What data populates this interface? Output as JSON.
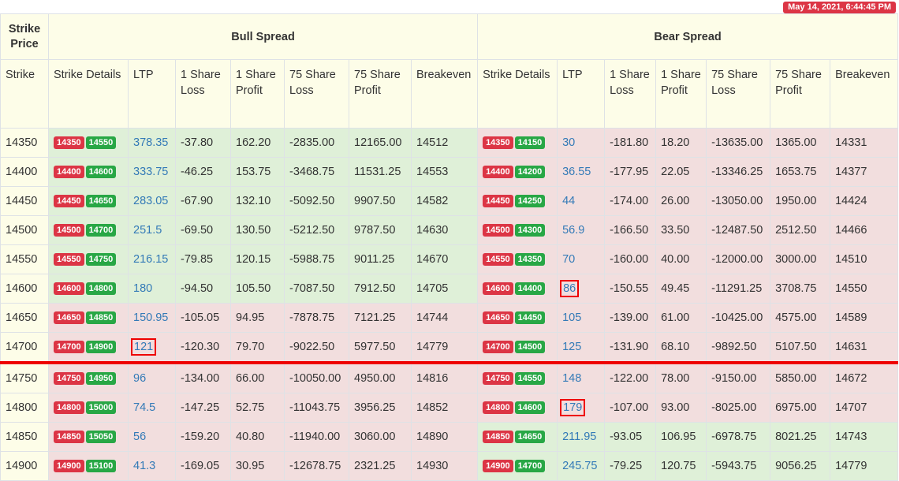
{
  "timestamp": "May 14, 2021, 6:44:45 PM",
  "header": {
    "strike_price": "Strike Price",
    "bull_spread": "Bull Spread",
    "bear_spread": "Bear Spread",
    "columns": [
      "Strike",
      "Strike Details",
      "LTP",
      "1 Share Loss",
      "1 Share Profit",
      "75 Share Loss",
      "75 Share Profit",
      "Breakeven",
      "Strike Details",
      "LTP",
      "1 Share Loss",
      "1 Share Profit",
      "75 Share Loss",
      "75 Share Profit",
      "Breakeven"
    ]
  },
  "colors": {
    "bull_bg": "#dff0d8",
    "bear_bg": "#f2dede",
    "header_bg": "#fdfde8",
    "pill_low": "#dc3545",
    "pill_high": "#28a745",
    "ltp": "#337ab7"
  },
  "rows": [
    {
      "strike": "14350",
      "bull": {
        "k1": "14350",
        "k2": "14550",
        "ltp": "378.35",
        "loss1": "-37.80",
        "profit1": "162.20",
        "loss75": "-2835.00",
        "profit75": "12165.00",
        "be": "14512"
      },
      "bear": {
        "k1": "14350",
        "k2": "14150",
        "ltp": "30",
        "loss1": "-181.80",
        "profit1": "18.20",
        "loss75": "-13635.00",
        "profit75": "1365.00",
        "be": "14331"
      },
      "bull_color": "g",
      "bear_color": "r"
    },
    {
      "strike": "14400",
      "bull": {
        "k1": "14400",
        "k2": "14600",
        "ltp": "333.75",
        "loss1": "-46.25",
        "profit1": "153.75",
        "loss75": "-3468.75",
        "profit75": "11531.25",
        "be": "14553"
      },
      "bear": {
        "k1": "14400",
        "k2": "14200",
        "ltp": "36.55",
        "loss1": "-177.95",
        "profit1": "22.05",
        "loss75": "-13346.25",
        "profit75": "1653.75",
        "be": "14377"
      },
      "bull_color": "g",
      "bear_color": "r"
    },
    {
      "strike": "14450",
      "bull": {
        "k1": "14450",
        "k2": "14650",
        "ltp": "283.05",
        "loss1": "-67.90",
        "profit1": "132.10",
        "loss75": "-5092.50",
        "profit75": "9907.50",
        "be": "14582"
      },
      "bear": {
        "k1": "14450",
        "k2": "14250",
        "ltp": "44",
        "loss1": "-174.00",
        "profit1": "26.00",
        "loss75": "-13050.00",
        "profit75": "1950.00",
        "be": "14424"
      },
      "bull_color": "g",
      "bear_color": "r"
    },
    {
      "strike": "14500",
      "bull": {
        "k1": "14500",
        "k2": "14700",
        "ltp": "251.5",
        "loss1": "-69.50",
        "profit1": "130.50",
        "loss75": "-5212.50",
        "profit75": "9787.50",
        "be": "14630"
      },
      "bear": {
        "k1": "14500",
        "k2": "14300",
        "ltp": "56.9",
        "loss1": "-166.50",
        "profit1": "33.50",
        "loss75": "-12487.50",
        "profit75": "2512.50",
        "be": "14466"
      },
      "bull_color": "g",
      "bear_color": "r"
    },
    {
      "strike": "14550",
      "bull": {
        "k1": "14550",
        "k2": "14750",
        "ltp": "216.15",
        "loss1": "-79.85",
        "profit1": "120.15",
        "loss75": "-5988.75",
        "profit75": "9011.25",
        "be": "14670"
      },
      "bear": {
        "k1": "14550",
        "k2": "14350",
        "ltp": "70",
        "loss1": "-160.00",
        "profit1": "40.00",
        "loss75": "-12000.00",
        "profit75": "3000.00",
        "be": "14510"
      },
      "bull_color": "g",
      "bear_color": "r"
    },
    {
      "strike": "14600",
      "bull": {
        "k1": "14600",
        "k2": "14800",
        "ltp": "180",
        "loss1": "-94.50",
        "profit1": "105.50",
        "loss75": "-7087.50",
        "profit75": "7912.50",
        "be": "14705"
      },
      "bear": {
        "k1": "14600",
        "k2": "14400",
        "ltp": "86",
        "loss1": "-150.55",
        "profit1": "49.45",
        "loss75": "-11291.25",
        "profit75": "3708.75",
        "be": "14550"
      },
      "bull_color": "g",
      "bear_color": "r",
      "bear_hl": true
    },
    {
      "strike": "14650",
      "bull": {
        "k1": "14650",
        "k2": "14850",
        "ltp": "150.95",
        "loss1": "-105.05",
        "profit1": "94.95",
        "loss75": "-7878.75",
        "profit75": "7121.25",
        "be": "14744"
      },
      "bear": {
        "k1": "14650",
        "k2": "14450",
        "ltp": "105",
        "loss1": "-139.00",
        "profit1": "61.00",
        "loss75": "-10425.00",
        "profit75": "4575.00",
        "be": "14589"
      },
      "bull_color": "r",
      "bear_color": "r"
    },
    {
      "strike": "14700",
      "bull": {
        "k1": "14700",
        "k2": "14900",
        "ltp": "121",
        "loss1": "-120.30",
        "profit1": "79.70",
        "loss75": "-9022.50",
        "profit75": "5977.50",
        "be": "14779"
      },
      "bear": {
        "k1": "14700",
        "k2": "14500",
        "ltp": "125",
        "loss1": "-131.90",
        "profit1": "68.10",
        "loss75": "-9892.50",
        "profit75": "5107.50",
        "be": "14631"
      },
      "bull_color": "r",
      "bear_color": "r",
      "bull_hl": true
    },
    {
      "strike": "14750",
      "bull": {
        "k1": "14750",
        "k2": "14950",
        "ltp": "96",
        "loss1": "-134.00",
        "profit1": "66.00",
        "loss75": "-10050.00",
        "profit75": "4950.00",
        "be": "14816"
      },
      "bear": {
        "k1": "14750",
        "k2": "14550",
        "ltp": "148",
        "loss1": "-122.00",
        "profit1": "78.00",
        "loss75": "-9150.00",
        "profit75": "5850.00",
        "be": "14672"
      },
      "bull_color": "r",
      "bear_color": "r",
      "divider": true
    },
    {
      "strike": "14800",
      "bull": {
        "k1": "14800",
        "k2": "15000",
        "ltp": "74.5",
        "loss1": "-147.25",
        "profit1": "52.75",
        "loss75": "-11043.75",
        "profit75": "3956.25",
        "be": "14852"
      },
      "bear": {
        "k1": "14800",
        "k2": "14600",
        "ltp": "179",
        "loss1": "-107.00",
        "profit1": "93.00",
        "loss75": "-8025.00",
        "profit75": "6975.00",
        "be": "14707"
      },
      "bull_color": "r",
      "bear_color": "r",
      "bear_hl": true
    },
    {
      "strike": "14850",
      "bull": {
        "k1": "14850",
        "k2": "15050",
        "ltp": "56",
        "loss1": "-159.20",
        "profit1": "40.80",
        "loss75": "-11940.00",
        "profit75": "3060.00",
        "be": "14890"
      },
      "bear": {
        "k1": "14850",
        "k2": "14650",
        "ltp": "211.95",
        "loss1": "-93.05",
        "profit1": "106.95",
        "loss75": "-6978.75",
        "profit75": "8021.25",
        "be": "14743"
      },
      "bull_color": "r",
      "bear_color": "g"
    },
    {
      "strike": "14900",
      "bull": {
        "k1": "14900",
        "k2": "15100",
        "ltp": "41.3",
        "loss1": "-169.05",
        "profit1": "30.95",
        "loss75": "-12678.75",
        "profit75": "2321.25",
        "be": "14930"
      },
      "bear": {
        "k1": "14900",
        "k2": "14700",
        "ltp": "245.75",
        "loss1": "-79.25",
        "profit1": "120.75",
        "loss75": "-5943.75",
        "profit75": "9056.25",
        "be": "14779"
      },
      "bull_color": "r",
      "bear_color": "g"
    }
  ]
}
